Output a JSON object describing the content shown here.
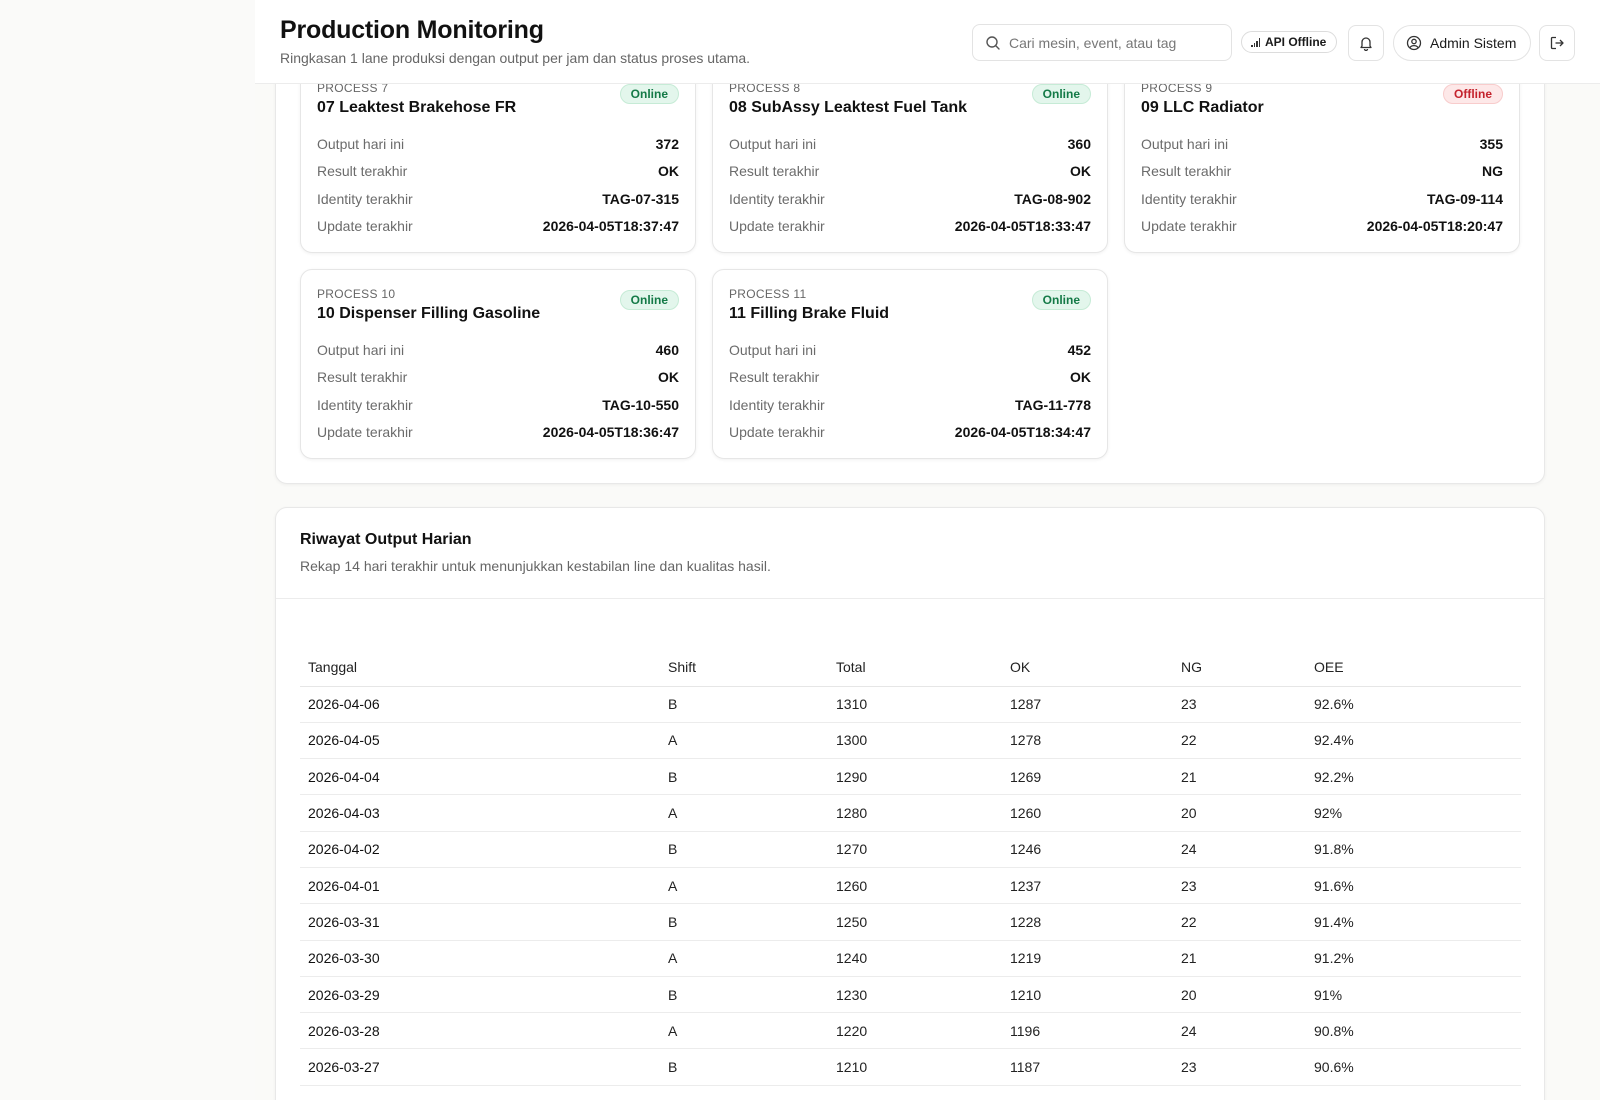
{
  "header": {
    "title": "Production Monitoring",
    "subtitle": "Ringkasan 1 lane produksi dengan output per jam dan status proses utama.",
    "search_placeholder": "Cari mesin, event, atau tag",
    "api_status": "API Offline",
    "user_name": "Admin Sistem"
  },
  "cards": [
    {
      "process": "PROCESS 7",
      "title": "07 Leaktest Brakehose FR",
      "status": "Online",
      "rows": [
        {
          "label": "Output hari ini",
          "value": "372"
        },
        {
          "label": "Result terakhir",
          "value": "OK"
        },
        {
          "label": "Identity terakhir",
          "value": "TAG-07-315"
        },
        {
          "label": "Update terakhir",
          "value": "2026-04-05T18:37:47"
        }
      ]
    },
    {
      "process": "PROCESS 8",
      "title": "08 SubAssy Leaktest Fuel Tank",
      "status": "Online",
      "rows": [
        {
          "label": "Output hari ini",
          "value": "360"
        },
        {
          "label": "Result terakhir",
          "value": "OK"
        },
        {
          "label": "Identity terakhir",
          "value": "TAG-08-902"
        },
        {
          "label": "Update terakhir",
          "value": "2026-04-05T18:33:47"
        }
      ]
    },
    {
      "process": "PROCESS 9",
      "title": "09 LLC Radiator",
      "status": "Offline",
      "rows": [
        {
          "label": "Output hari ini",
          "value": "355"
        },
        {
          "label": "Result terakhir",
          "value": "NG"
        },
        {
          "label": "Identity terakhir",
          "value": "TAG-09-114"
        },
        {
          "label": "Update terakhir",
          "value": "2026-04-05T18:20:47"
        }
      ]
    },
    {
      "process": "PROCESS 10",
      "title": "10 Dispenser Filling Gasoline",
      "status": "Online",
      "rows": [
        {
          "label": "Output hari ini",
          "value": "460"
        },
        {
          "label": "Result terakhir",
          "value": "OK"
        },
        {
          "label": "Identity terakhir",
          "value": "TAG-10-550"
        },
        {
          "label": "Update terakhir",
          "value": "2026-04-05T18:36:47"
        }
      ]
    },
    {
      "process": "PROCESS 11",
      "title": "11 Filling Brake Fluid",
      "status": "Online",
      "rows": [
        {
          "label": "Output hari ini",
          "value": "452"
        },
        {
          "label": "Result terakhir",
          "value": "OK"
        },
        {
          "label": "Identity terakhir",
          "value": "TAG-11-778"
        },
        {
          "label": "Update terakhir",
          "value": "2026-04-05T18:34:47"
        }
      ]
    }
  ],
  "history": {
    "title": "Riwayat Output Harian",
    "subtitle": "Rekap 14 hari terakhir untuk menunjukkan kestabilan line dan kualitas hasil.",
    "columns": [
      "Tanggal",
      "Shift",
      "Total",
      "OK",
      "NG",
      "OEE"
    ],
    "rows": [
      [
        "2026-04-06",
        "B",
        "1310",
        "1287",
        "23",
        "92.6%"
      ],
      [
        "2026-04-05",
        "A",
        "1300",
        "1278",
        "22",
        "92.4%"
      ],
      [
        "2026-04-04",
        "B",
        "1290",
        "1269",
        "21",
        "92.2%"
      ],
      [
        "2026-04-03",
        "A",
        "1280",
        "1260",
        "20",
        "92%"
      ],
      [
        "2026-04-02",
        "B",
        "1270",
        "1246",
        "24",
        "91.8%"
      ],
      [
        "2026-04-01",
        "A",
        "1260",
        "1237",
        "23",
        "91.6%"
      ],
      [
        "2026-03-31",
        "B",
        "1250",
        "1228",
        "22",
        "91.4%"
      ],
      [
        "2026-03-30",
        "A",
        "1240",
        "1219",
        "21",
        "91.2%"
      ],
      [
        "2026-03-29",
        "B",
        "1230",
        "1210",
        "20",
        "91%"
      ],
      [
        "2026-03-28",
        "A",
        "1220",
        "1196",
        "24",
        "90.8%"
      ],
      [
        "2026-03-27",
        "B",
        "1210",
        "1187",
        "23",
        "90.6%"
      ]
    ]
  },
  "colors": {
    "online_bg": "#e3f6ec",
    "online_text": "#147a47",
    "offline_bg": "#fde8e8",
    "offline_text": "#c4232d"
  },
  "icons": {
    "search": "search-icon",
    "signal": "signal-icon",
    "bell": "bell-icon",
    "user": "user-circle-icon",
    "logout": "logout-icon"
  }
}
